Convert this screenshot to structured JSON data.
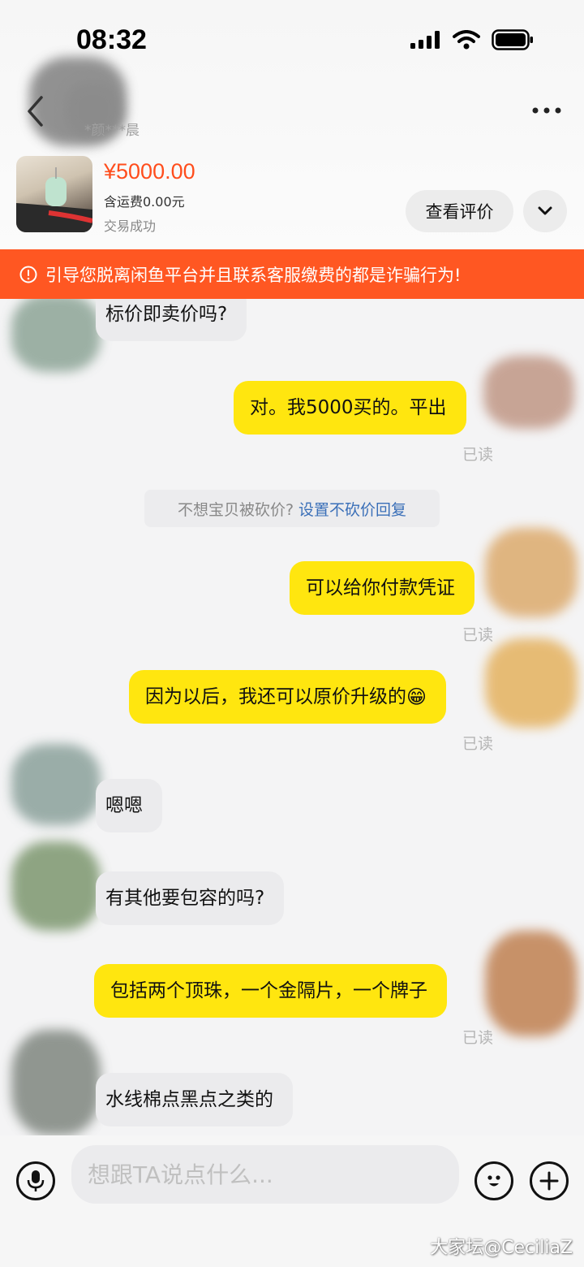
{
  "status_bar": {
    "time": "08:32",
    "icons": [
      "cellular-signal-icon",
      "wifi-icon",
      "battery-icon"
    ]
  },
  "nav": {
    "back_icon": "chevron-left-icon",
    "contact_name": "*颜***晨",
    "more_icon": "more-horizontal-icon"
  },
  "product": {
    "price": "¥5000.00",
    "shipping": "含运费0.00元",
    "status": "交易成功",
    "review_label": "查看评价",
    "expand_icon": "chevron-down-icon"
  },
  "warning": {
    "icon": "exclamation-circle-icon",
    "text": "引导您脱离闲鱼平台并且联系客服缴费的都是诈骗行为!"
  },
  "messages": [
    {
      "direction": "in",
      "text": "标价即卖价吗?"
    },
    {
      "direction": "out",
      "text": "对。我5000买的。平出",
      "status": "已读"
    },
    {
      "direction": "out",
      "text": "可以给你付款凭证",
      "status": "已读"
    },
    {
      "direction": "out",
      "text": "因为以后，我还可以原价升级的",
      "emoji": "😁",
      "status": "已读"
    },
    {
      "direction": "in",
      "text": "嗯嗯"
    },
    {
      "direction": "in",
      "text": "有其他要包容的吗?"
    },
    {
      "direction": "out",
      "text": "包括两个顶珠，一个金隔片，一个牌子",
      "status": "已读"
    },
    {
      "direction": "in",
      "text": "水线棉点黑点之类的"
    }
  ],
  "system_tip": {
    "text": "不想宝贝被砍价?",
    "link": "设置不砍价回复"
  },
  "input_bar": {
    "placeholder": "想跟TA说点什么...",
    "voice_icon": "microphone-icon",
    "emoji_icon": "smiley-icon",
    "plus_icon": "plus-circle-icon"
  },
  "watermark": "大家坛@CeciliaZ",
  "colors": {
    "price": "#ff4d1c",
    "warning_bg": "#ff5722",
    "outgoing_bubble": "#ffe60f",
    "incoming_bubble": "#ebebed",
    "link": "#3a6fb8"
  }
}
